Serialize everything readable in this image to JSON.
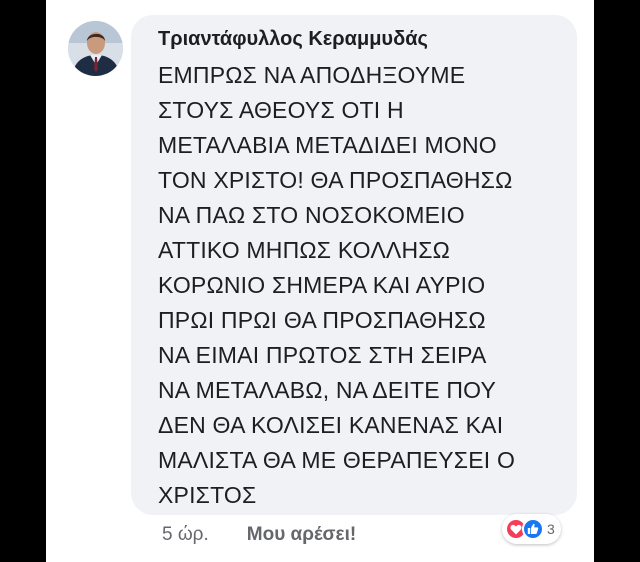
{
  "comment": {
    "author": "Τριαντάφυλλος Κεραμμυδάς",
    "avatar_icon": "profile-photo",
    "lines": [
      "ΕΜΠΡΩΣ ΝΑ ΑΠΟΔΗΞΟΥΜΕ",
      "ΣΤΟΥΣ ΑΘΕΟΥΣ ΟΤΙ Η",
      "ΜΕΤΑΛΑΒΙΑ ΜΕΤΑΔΙΔΕΙ ΜΟΝΟ",
      "ΤΟΝ ΧΡΙΣΤΟ! ΘΑ ΠΡΟΣΠΑΘΗΣΩ",
      "ΝΑ ΠΑΩ ΣΤΟ ΝΟΣΟΚΟΜΕΙΟ",
      "ΑΤΤΙΚΟ ΜΗΠΩΣ ΚΟΛΛΗΣΩ",
      "ΚΟΡΩΝΙΟ ΣΗΜΕΡΑ ΚΑΙ ΑΥΡΙΟ",
      "ΠΡΩΙ ΠΡΩΙ ΘΑ ΠΡΟΣΠΑΘΗΣΩ",
      "ΝΑ ΕΙΜΑΙ ΠΡΩΤΟΣ ΣΤΗ ΣΕΙΡΑ",
      "ΝΑ ΜΕΤΑΛΑΒΩ, ΝΑ ΔΕΙΤΕ ΠΟΥ",
      "ΔΕΝ ΘΑ ΚΟΛΙΣΕΙ ΚΑΝΕΝΑΣ ΚΑΙ",
      "ΜΑΛΙΣΤΑ ΘΑ ΜΕ ΘΕΡΑΠΕΥΣΕΙ Ο",
      "ΧΡΙΣΤΟΣ"
    ]
  },
  "footer": {
    "timestamp": "5 ώρ.",
    "like_label": "Μου αρέσει!"
  },
  "reactions": {
    "icons": [
      "love-reaction-icon",
      "like-reaction-icon"
    ],
    "count": "3"
  },
  "colors": {
    "background": "#000000",
    "bubble": "#f0f2f5",
    "text": "#1c1e21",
    "secondary_text": "#65676b",
    "love": "#f33e58",
    "like": "#1877f2"
  }
}
